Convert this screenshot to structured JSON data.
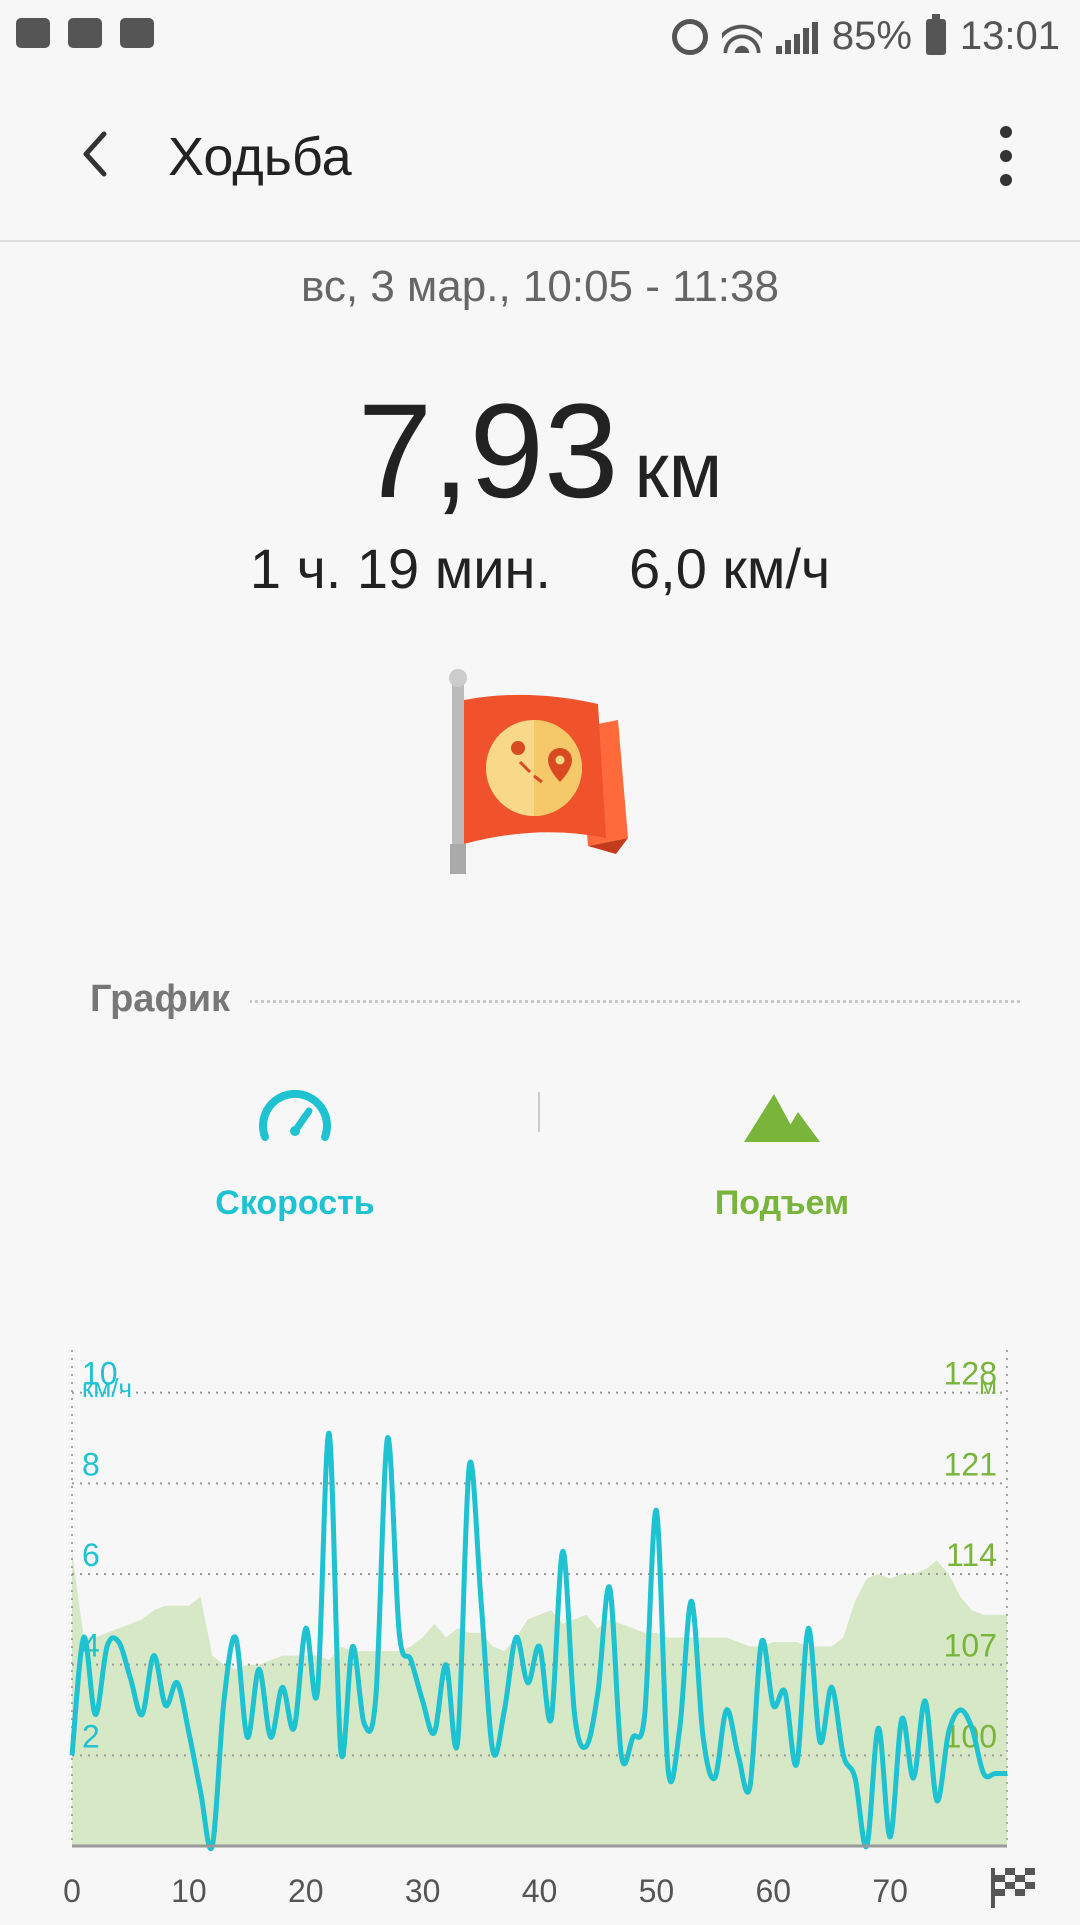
{
  "header": {
    "title": "Ходьба"
  },
  "status_bar": {
    "battery": "85%",
    "time": "13:01"
  },
  "session": {
    "date": "вс, 3 мар., 10:05 - 11:38",
    "distance_value": "7,93",
    "distance_unit": "км",
    "duration": "1 ч. 19 мин.",
    "avg_speed": "6,0 км/ч"
  },
  "graph_section": {
    "label": "График",
    "tabs": [
      {
        "label": "Скорость",
        "icon": "speedometer-icon",
        "color": "#1ec2d1"
      },
      {
        "label": "Подъем",
        "icon": "mountain-icon",
        "color": "#79b43b"
      }
    ]
  },
  "chart_data": {
    "type": "line",
    "y_left_unit": "км/ч",
    "y_right_unit": "м",
    "y_left_ticks": [
      "10",
      "8",
      "6",
      "4",
      "2"
    ],
    "y_right_ticks": [
      "128",
      "121",
      "114",
      "107",
      "100"
    ],
    "x_ticks": [
      "0",
      "10",
      "20",
      "30",
      "40",
      "50",
      "60",
      "70"
    ],
    "ylim": [
      0,
      10.5
    ],
    "xlim": [
      0,
      80
    ],
    "speed_color": "#1ec2d1",
    "elevation_color": "#d6e8c6",
    "series": [
      {
        "name": "Скорость",
        "x": [
          0,
          1,
          2,
          3,
          4,
          5,
          6,
          7,
          8,
          9,
          10,
          11,
          12,
          13,
          14,
          15,
          16,
          17,
          18,
          19,
          20,
          21,
          22,
          23,
          24,
          25,
          26,
          27,
          28,
          29,
          30,
          31,
          32,
          33,
          34,
          35,
          36,
          37,
          38,
          39,
          40,
          41,
          42,
          43,
          44,
          45,
          46,
          47,
          48,
          49,
          50,
          51,
          52,
          53,
          54,
          55,
          56,
          57,
          58,
          59,
          60,
          61,
          62,
          63,
          64,
          65,
          66,
          67,
          68,
          69,
          70,
          71,
          72,
          73,
          74,
          75,
          76,
          77,
          78,
          79,
          80
        ],
        "values": [
          2.0,
          4.6,
          2.9,
          4.4,
          4.5,
          3.7,
          2.9,
          4.2,
          3.1,
          3.6,
          2.5,
          1.2,
          0.0,
          3.2,
          4.6,
          2.4,
          3.9,
          2.4,
          3.5,
          2.6,
          4.8,
          3.4,
          9.1,
          2.1,
          4.4,
          2.7,
          3.3,
          9.0,
          4.7,
          4.1,
          3.2,
          2.5,
          4.0,
          2.3,
          8.4,
          5.4,
          2.1,
          3.0,
          4.6,
          3.6,
          4.4,
          2.8,
          6.5,
          2.9,
          2.2,
          3.4,
          5.7,
          2.0,
          2.4,
          2.9,
          7.4,
          1.7,
          2.6,
          5.4,
          2.4,
          1.5,
          3.0,
          2.0,
          1.3,
          4.5,
          3.1,
          3.4,
          1.8,
          4.8,
          2.3,
          3.5,
          2.0,
          1.5,
          0.0,
          2.6,
          0.2,
          2.8,
          1.5,
          3.2,
          1.0,
          2.5,
          3.0,
          2.6,
          1.6,
          1.6,
          1.6
        ]
      },
      {
        "name": "Подъем",
        "x": [
          0,
          1,
          2,
          3,
          4,
          5,
          6,
          7,
          8,
          9,
          10,
          11,
          12,
          13,
          14,
          15,
          16,
          17,
          18,
          19,
          20,
          21,
          22,
          23,
          24,
          25,
          26,
          27,
          28,
          29,
          30,
          31,
          32,
          33,
          34,
          35,
          36,
          37,
          38,
          39,
          40,
          41,
          42,
          43,
          44,
          45,
          46,
          47,
          48,
          49,
          50,
          51,
          52,
          53,
          54,
          55,
          56,
          57,
          58,
          59,
          60,
          61,
          62,
          63,
          64,
          65,
          66,
          67,
          68,
          69,
          70,
          71,
          72,
          73,
          74,
          75,
          76,
          77,
          78,
          79,
          80
        ],
        "values": [
          6.5,
          4.6,
          4.6,
          4.7,
          4.8,
          4.9,
          5.0,
          5.2,
          5.3,
          5.3,
          5.3,
          5.5,
          4.2,
          4.0,
          3.9,
          4.0,
          4.0,
          4.1,
          4.2,
          4.2,
          4.2,
          4.2,
          4.1,
          4.4,
          4.3,
          4.3,
          4.3,
          4.3,
          4.3,
          4.4,
          4.6,
          4.9,
          4.6,
          4.8,
          4.7,
          4.7,
          4.4,
          4.3,
          4.6,
          5.0,
          5.1,
          5.2,
          4.9,
          5.0,
          5.1,
          4.8,
          5.0,
          4.9,
          4.8,
          4.7,
          4.7,
          4.6,
          4.6,
          4.6,
          4.6,
          4.6,
          4.6,
          4.5,
          4.4,
          4.4,
          4.5,
          4.5,
          4.5,
          4.4,
          4.4,
          4.4,
          4.6,
          5.4,
          5.9,
          6.0,
          5.9,
          6.0,
          6.0,
          6.1,
          6.3,
          6.0,
          5.5,
          5.2,
          5.1,
          5.1,
          5.1
        ]
      }
    ]
  }
}
